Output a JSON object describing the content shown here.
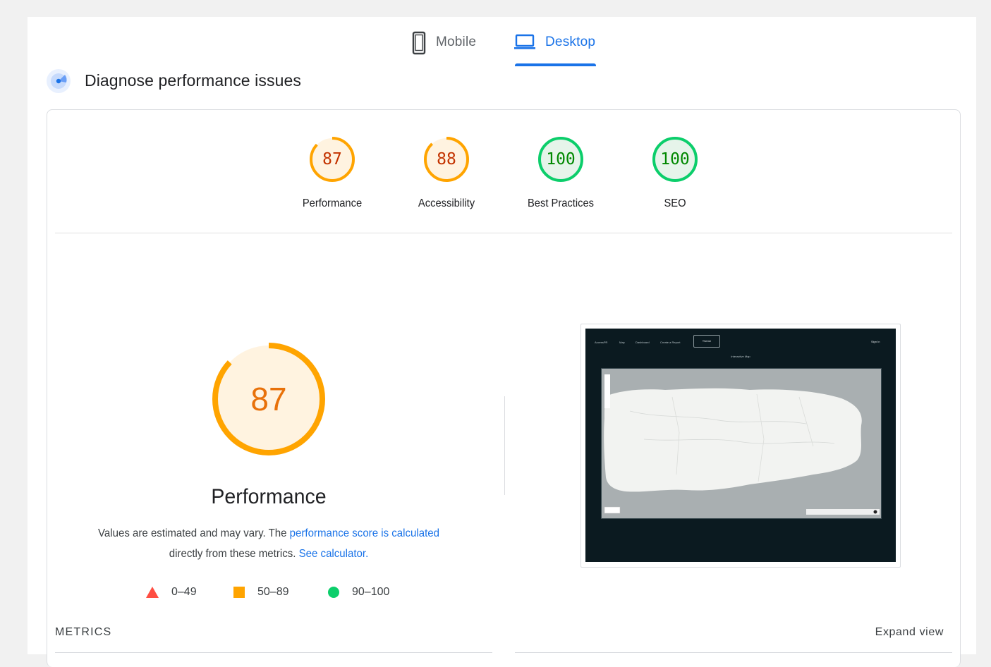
{
  "tabs": {
    "mobile_label": "Mobile",
    "desktop_label": "Desktop",
    "active": "Desktop"
  },
  "header": {
    "title": "Diagnose performance issues"
  },
  "categories": [
    {
      "label": "Performance",
      "score": 87,
      "status": "average",
      "color": "#e8710a",
      "ring": "#ffa400",
      "fill": "#fff3e0"
    },
    {
      "label": "Accessibility",
      "score": 88,
      "status": "average",
      "color": "#e8710a",
      "ring": "#ffa400",
      "fill": "#fff3e0"
    },
    {
      "label": "Best Practices",
      "score": 100,
      "status": "pass",
      "color": "#0a8f3c",
      "ring": "#0cce6b",
      "fill": "#e6f4ea"
    },
    {
      "label": "SEO",
      "score": 100,
      "status": "pass",
      "color": "#0a8f3c",
      "ring": "#0cce6b",
      "fill": "#e6f4ea"
    }
  ],
  "performance": {
    "score": 87,
    "title": "Performance",
    "desc_prefix": "Values are estimated and may vary. The ",
    "desc_link1": "performance score is calculated",
    "desc_middle": "directly from these metrics.",
    "desc_link2": "See calculator."
  },
  "legend": [
    {
      "range": "0–49",
      "shape": "triangle-icon",
      "color": "#ff4e42"
    },
    {
      "range": "50–89",
      "shape": "square-icon",
      "color": "#ffa400"
    },
    {
      "range": "90–100",
      "shape": "circle-icon",
      "color": "#0cce6b"
    }
  ],
  "screenshot": {
    "nav_items": [
      "AccessPR",
      "Map",
      "Dashboard",
      "Create a Report"
    ],
    "theme_button": "Theme",
    "signin": "Sign In",
    "map_title": "Interactive Map"
  },
  "metrics": {
    "label": "METRICS",
    "expand_label": "Expand view"
  },
  "colors": {
    "accent": "#1a73e8",
    "average": "#ffa400",
    "pass": "#0cce6b",
    "fail": "#ff4e42"
  }
}
